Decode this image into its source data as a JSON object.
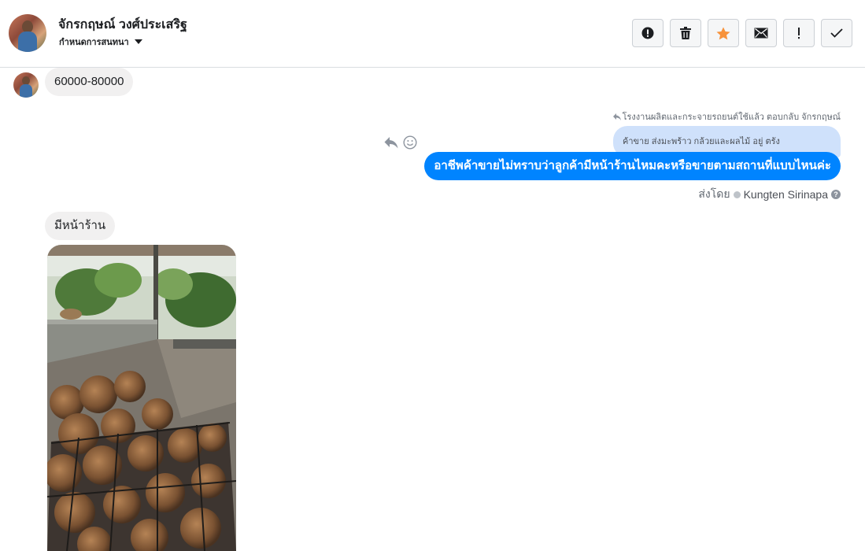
{
  "header": {
    "contact_name": "จักรกฤษณ์ วงศ์ประเสริฐ",
    "assign_label": "กำหนดการสนทนา",
    "actions": [
      {
        "name": "spam-button",
        "icon": "alert-circle-icon"
      },
      {
        "name": "delete-button",
        "icon": "trash-icon"
      },
      {
        "name": "star-button",
        "icon": "star-icon"
      },
      {
        "name": "mark-unread-button",
        "icon": "envelope-icon"
      },
      {
        "name": "follow-up-button",
        "icon": "exclamation-icon"
      },
      {
        "name": "mark-done-button",
        "icon": "checkmark-icon"
      }
    ]
  },
  "conversation": {
    "incoming_1": "60000-80000",
    "reply_context": "โรงงานผลิตและกระจายรถยนต์ใช้แล้ว ตอบกลับ จักรกฤษณ์",
    "quoted_text": "ค้าขาย ส่งมะพร้าว กล้วยและผลไม้ อยู่ ตรัง",
    "outgoing_1": "อาชีพค้าขายไม่ทราบว่าลูกค้ามีหน้าร้านไหมคะหรือขายตามสถานที่แบบไหนค่ะ",
    "sent_by_label": "ส่งโดย",
    "sent_by_agent": "Kungten Sirinapa",
    "incoming_2": "มีหน้าร้าน"
  },
  "colors": {
    "accent_blue": "#0084ff",
    "quoted_bubble": "#cfe1fb",
    "incoming_bubble": "#f1f0f0",
    "star": "#f7923b"
  }
}
